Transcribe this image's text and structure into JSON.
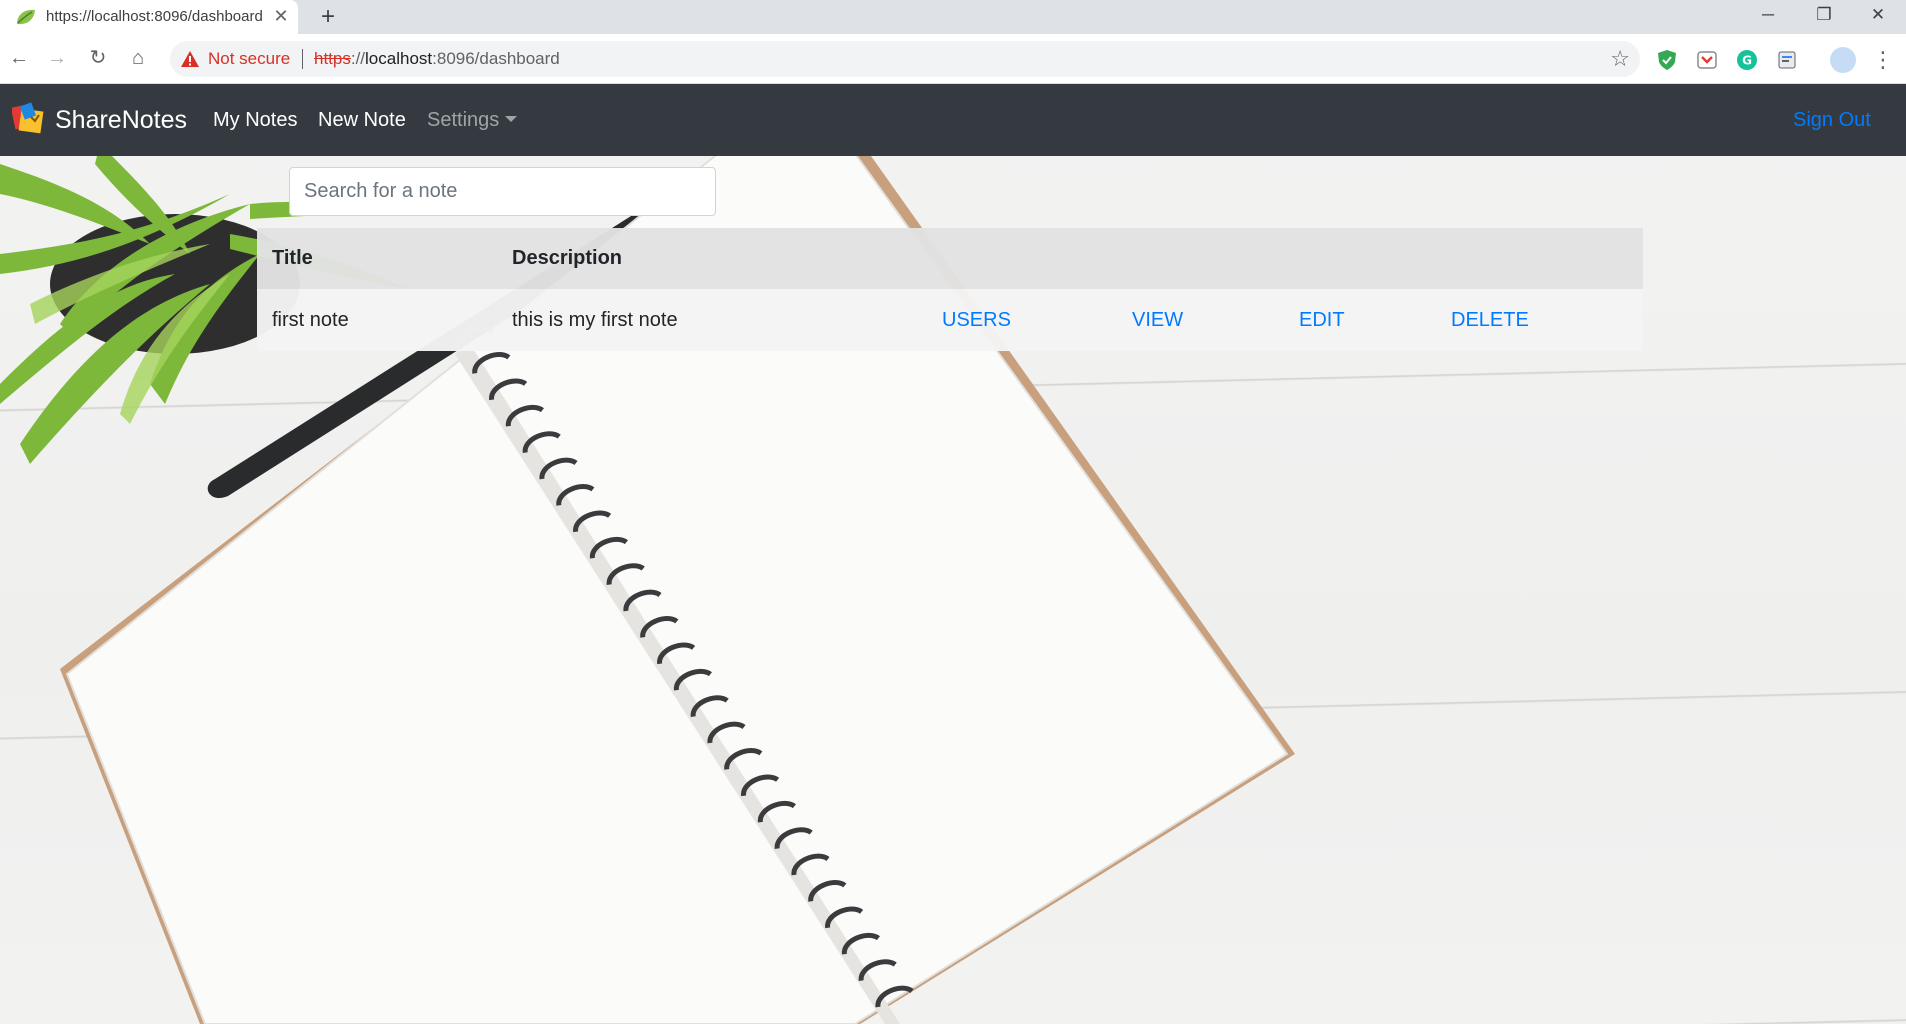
{
  "browser": {
    "tab_title": "https://localhost:8096/dashboard",
    "new_tab_symbol": "+",
    "security_label": "Not secure",
    "url_scheme": "https",
    "url_sep": "://",
    "url_host": "localhost",
    "url_rest": ":8096/dashboard",
    "window_controls": [
      "minimize-icon",
      "restore-icon",
      "close-icon"
    ],
    "extensions": [
      "shield-extension-icon",
      "pocket-extension-icon",
      "grammarly-extension-icon",
      "translate-extension-icon"
    ]
  },
  "navbar": {
    "brand": "ShareNotes",
    "links": [
      "My Notes",
      "New Note",
      "Settings"
    ],
    "sign_out": "Sign Out"
  },
  "search": {
    "placeholder": "Search for a note",
    "value": ""
  },
  "table": {
    "headers": [
      "Title",
      "Description"
    ],
    "rows": [
      {
        "title": "first note",
        "description": "this is my first note",
        "actions": [
          "USERS",
          "VIEW",
          "EDIT",
          "DELETE"
        ]
      }
    ]
  },
  "colors": {
    "navbar_bg": "#343a40",
    "link_primary": "#007bff",
    "header_bg": "#e2e2e2",
    "row_bg": "#f4f4f4",
    "insecure_red": "#d93025"
  }
}
